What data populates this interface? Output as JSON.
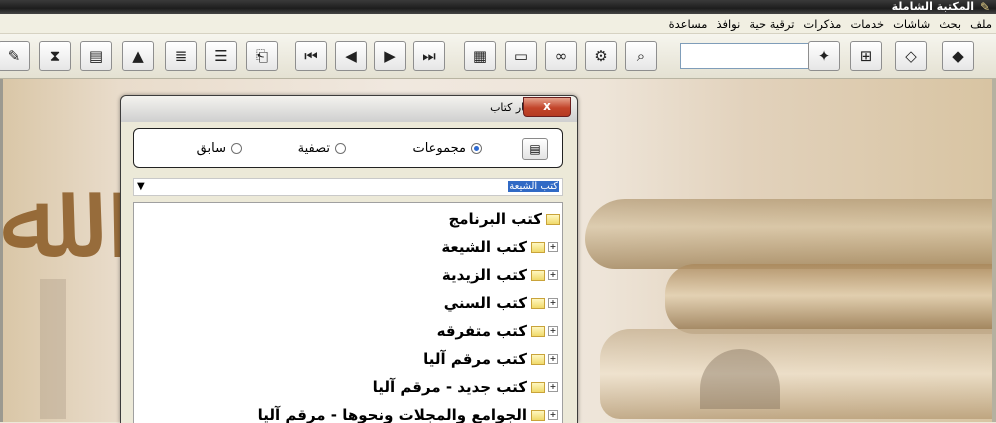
{
  "window": {
    "title": "المكتبة الشاملة",
    "icon": "quill-icon"
  },
  "menu": [
    "ملف",
    "بحث",
    "شاشات",
    "خدمات",
    "مذكرات",
    "ترقية حية",
    "نوافذ",
    "مساعدة"
  ],
  "toolbar": {
    "search_value": "",
    "buttons": [
      {
        "name": "book-icon",
        "glyph": "◆"
      },
      {
        "name": "open-book-icon",
        "glyph": "◇"
      },
      {
        "name": "tree-icon",
        "glyph": "⊞"
      },
      {
        "name": "bookmark-add-icon",
        "glyph": "✦"
      },
      {
        "name": "search-doc-icon",
        "glyph": "⌕"
      },
      {
        "name": "settings-doc-icon",
        "glyph": "⚙"
      },
      {
        "name": "binoculars-icon",
        "glyph": "∞"
      },
      {
        "name": "folder-open-icon",
        "glyph": "▭"
      },
      {
        "name": "window-icon",
        "glyph": "▦"
      },
      {
        "name": "last-icon",
        "glyph": "⏭"
      },
      {
        "name": "next-icon",
        "glyph": "▶"
      },
      {
        "name": "prev-icon",
        "glyph": "◀"
      },
      {
        "name": "first-icon",
        "glyph": "⏮"
      },
      {
        "name": "read-book-icon",
        "glyph": "⎗"
      },
      {
        "name": "list-icon",
        "glyph": "☰"
      },
      {
        "name": "numbered-list-icon",
        "glyph": "≣"
      },
      {
        "name": "pdf-icon",
        "glyph": "▲"
      },
      {
        "name": "properties-icon",
        "glyph": "▤"
      },
      {
        "name": "filter-icon",
        "glyph": "⧗"
      },
      {
        "name": "pencil-icon",
        "glyph": "✎"
      }
    ]
  },
  "dialog": {
    "title": "اختيار كتاب",
    "close_label": "x",
    "radios": [
      {
        "label": "مجموعات",
        "checked": true
      },
      {
        "label": "تصفية",
        "checked": false
      },
      {
        "label": "سابق",
        "checked": false
      }
    ],
    "combo_value": "كتب الشيعة",
    "tree": {
      "root": "كتب البرنامج",
      "items": [
        "كتب الشيعة",
        "كتب الزيدية",
        "كتب السني",
        "كتب متفرقه",
        "كتب مرقم آليا",
        "كتب جديد - مرقم آليا",
        "الجوامع والمجلات ونحوها - مرقم آليا"
      ]
    }
  },
  "colors": {
    "selection": "#316ac5",
    "close_button": "#c2442a"
  }
}
